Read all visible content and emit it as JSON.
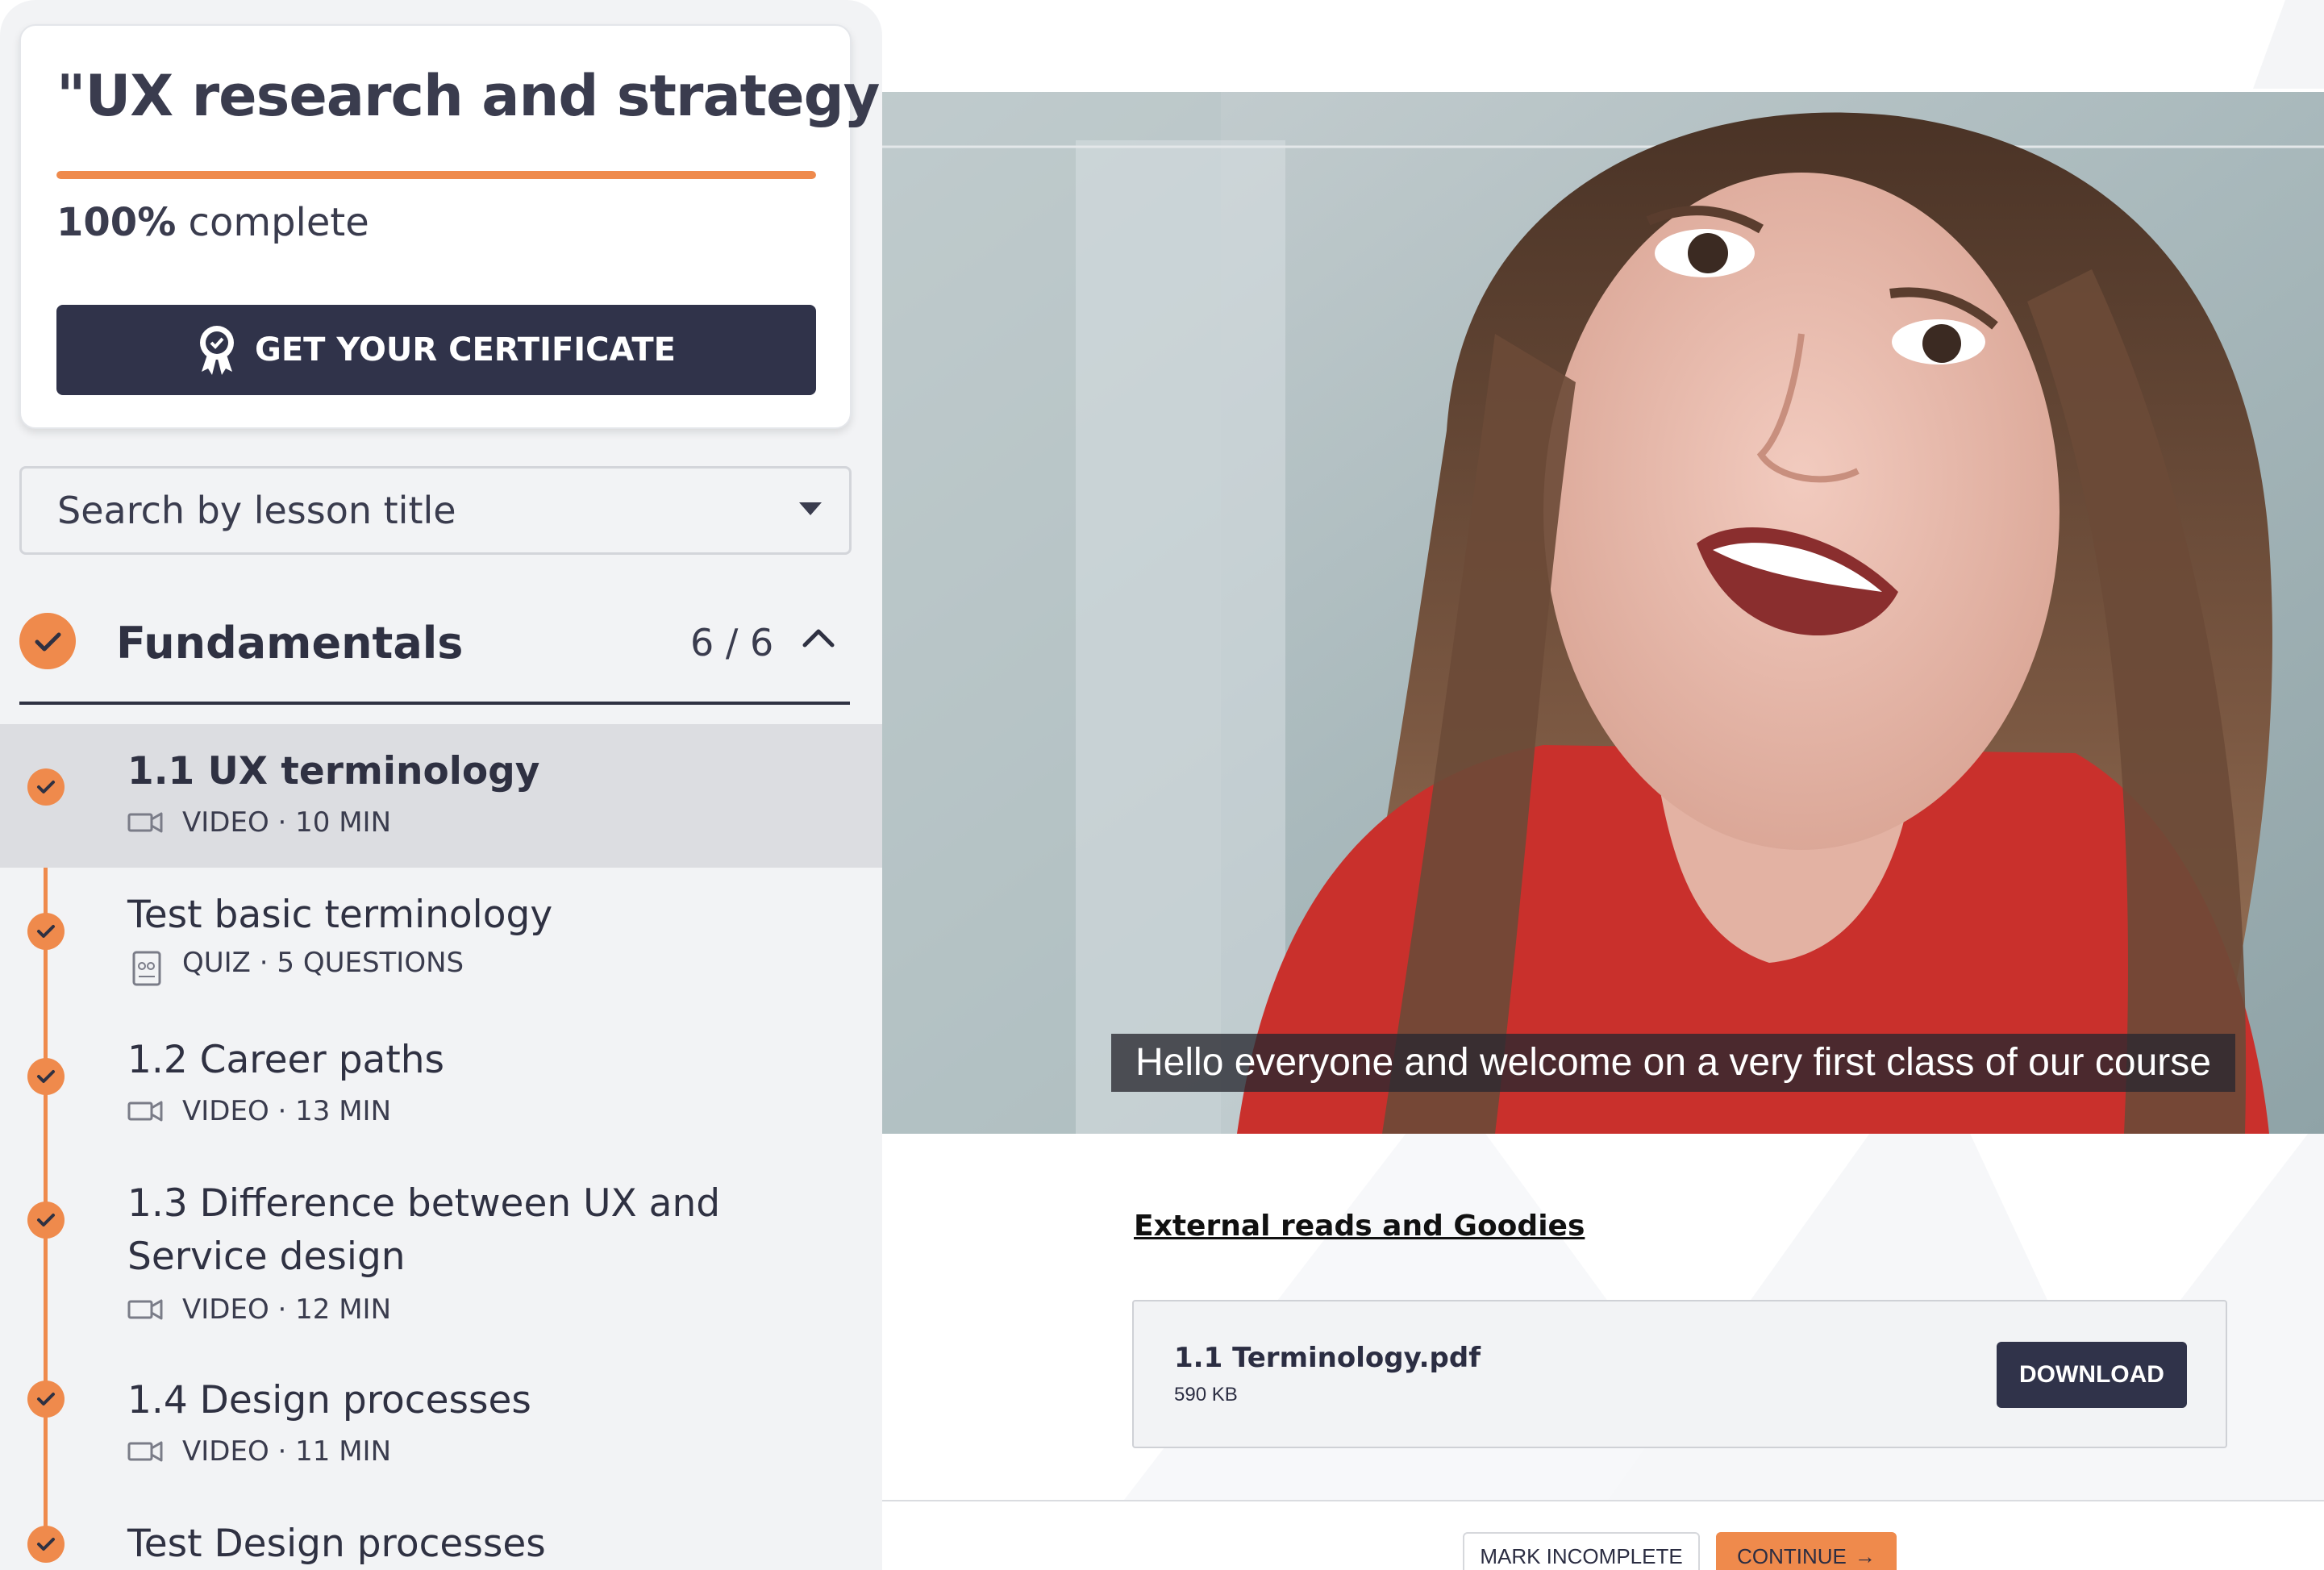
{
  "course": {
    "title": "\"UX research and strategy\"",
    "progress_percent": 100,
    "progress_value": "100%",
    "progress_suffix": " complete",
    "certificate_label": "GET YOUR CERTIFICATE"
  },
  "search": {
    "placeholder": "Search by lesson title"
  },
  "section": {
    "title": "Fundamentals",
    "count": "6 / 6",
    "completed": true,
    "expanded": true
  },
  "lessons": [
    {
      "title": "1.1 UX terminology",
      "meta": "VIDEO · 10 MIN",
      "type": "video",
      "completed": true,
      "active": true
    },
    {
      "title": "Test basic terminology",
      "meta": "QUIZ · 5 QUESTIONS",
      "type": "quiz",
      "completed": true,
      "active": false
    },
    {
      "title": "1.2 Career paths",
      "meta": "VIDEO · 13 MIN",
      "type": "video",
      "completed": true,
      "active": false
    },
    {
      "title": "1.3 Difference between UX and Service design",
      "meta": "VIDEO · 12 MIN",
      "type": "video",
      "completed": true,
      "active": false
    },
    {
      "title": "1.4 Design processes",
      "meta": "VIDEO · 11 MIN",
      "type": "video",
      "completed": true,
      "active": false
    },
    {
      "title": "Test Design processes",
      "meta": "",
      "type": "quiz",
      "completed": true,
      "active": false
    }
  ],
  "video": {
    "subtitle": "Hello everyone and welcome on a very first class of our course"
  },
  "resources": {
    "heading": "External reads and Goodies",
    "file_name": "1.1 Terminology.pdf",
    "file_size": "590 KB",
    "download_label": "DOWNLOAD"
  },
  "footer": {
    "mark_incomplete_label": "MARK INCOMPLETE",
    "continue_label": "CONTINUE",
    "continue_arrow": "→"
  },
  "colors": {
    "accent": "#ef8a4c",
    "dark": "#30334a",
    "sidebar_bg": "#f2f3f5",
    "active_row": "#dcdde1"
  },
  "icons": {
    "certificate": "award-ribbon-icon",
    "search_caret": "caret-down-icon",
    "section_toggle": "chevron-up-icon",
    "completed": "check-circle-icon",
    "video": "video-camera-icon",
    "quiz": "quiz-document-icon"
  }
}
